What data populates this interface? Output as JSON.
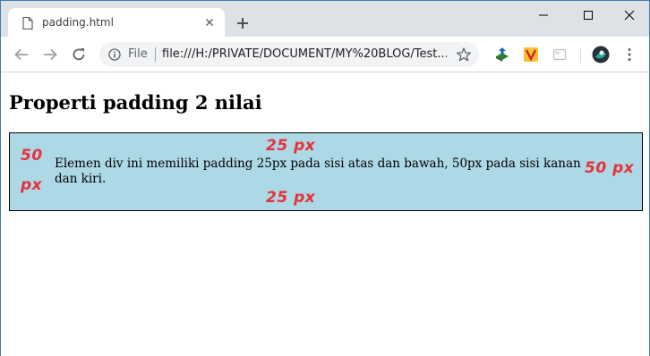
{
  "tab": {
    "title": "padding.html",
    "close_label": "×"
  },
  "toolbar": {
    "scheme_label": "File",
    "url": "file:///H:/PRIVATE/DOCUMENT/MY%20BLOG/Test..."
  },
  "page": {
    "heading": "Properti padding 2 nilai",
    "box_text": "Elemen div ini memiliki padding 25px pada sisi atas dan bawah, 50px pada sisi kanan dan kiri."
  },
  "annotations": {
    "top": "25 px",
    "bottom": "25 px",
    "left_line1": "50",
    "left_line2": "px",
    "right": "50 px"
  },
  "colors": {
    "tabstrip_bg": "#dee1e6",
    "box_bg": "#add8e6",
    "annotation": "#e8303a",
    "window_border": "#3c7fb1"
  },
  "icons": {
    "tab": "file-icon",
    "new_tab": "plus-icon",
    "back": "arrow-left-icon",
    "forward": "arrow-right-icon",
    "reload": "reload-icon",
    "info": "info-icon",
    "bookmark": "star-icon",
    "menu": "kebab-menu-icon"
  }
}
